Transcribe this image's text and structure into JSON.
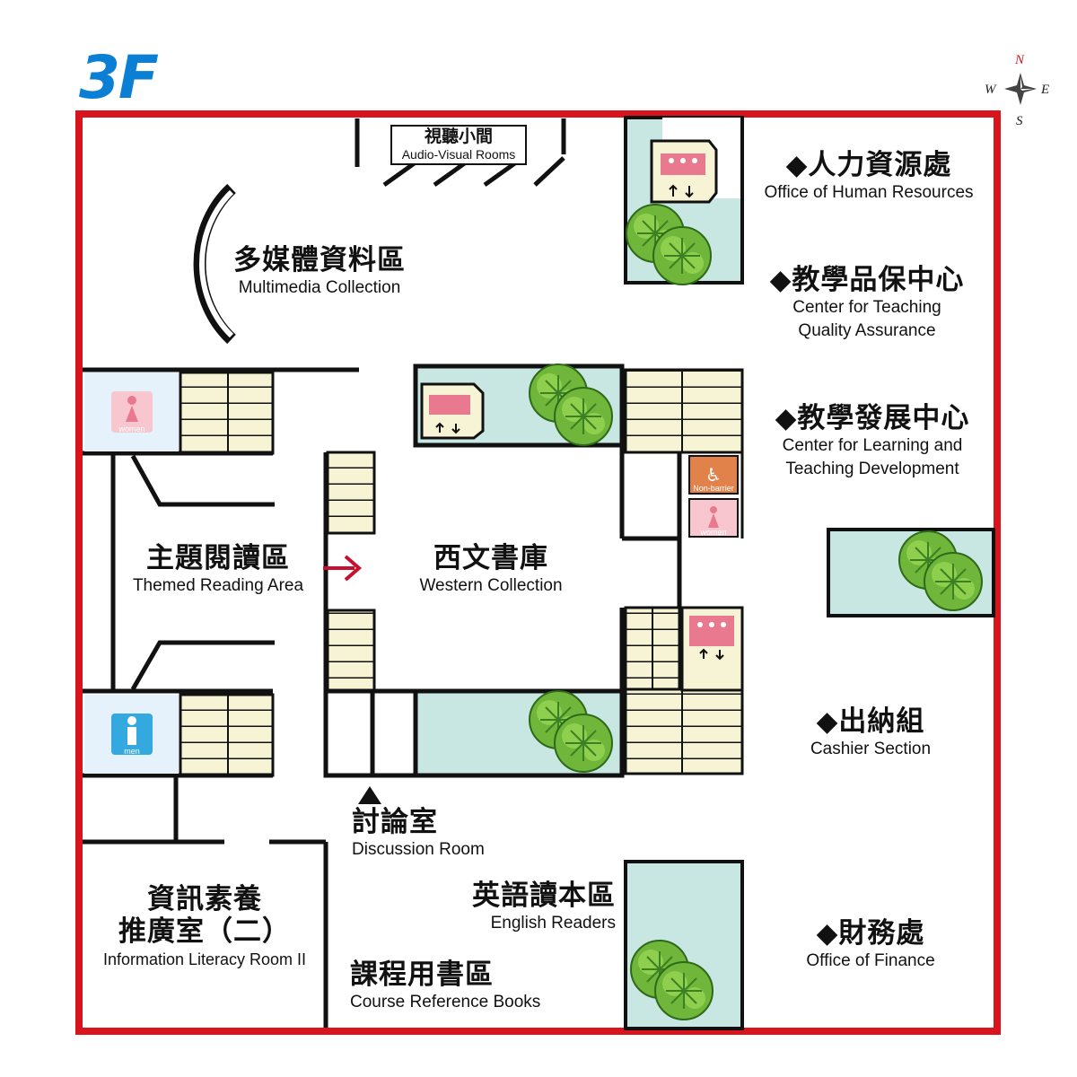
{
  "floor": "3F",
  "compass": {
    "n": "N",
    "s": "S",
    "e": "E",
    "w": "W"
  },
  "rooms": {
    "av_rooms": {
      "zh": "視聽小間",
      "en": "Audio-Visual Rooms"
    },
    "multimedia": {
      "zh": "多媒體資料區",
      "en": "Multimedia Collection"
    },
    "themed_reading": {
      "zh": "主題閱讀區",
      "en": "Themed Reading Area"
    },
    "western": {
      "zh": "西文書庫",
      "en": "Western Collection"
    },
    "discussion": {
      "zh": "討論室",
      "en": "Discussion Room"
    },
    "info_literacy": {
      "zh_line1": "資訊素養",
      "zh_line2": "推廣室（二）",
      "en": "Information Literacy Room II"
    },
    "english_readers": {
      "zh": "英語讀本區",
      "en": "English Readers"
    },
    "course_books": {
      "zh": "課程用書區",
      "en": "Course Reference Books"
    }
  },
  "offices": [
    {
      "zh": "◆人力資源處",
      "en": "Office of Human Resources"
    },
    {
      "zh": "◆教學品保中心",
      "en_line1": "Center for Teaching",
      "en_line2": "Quality Assurance"
    },
    {
      "zh": "◆教學發展中心",
      "en_line1": "Center for Learning and",
      "en_line2": "Teaching Development"
    },
    {
      "zh": "◆出納組",
      "en": "Cashier Section"
    },
    {
      "zh": "◆財務處",
      "en": "Office of Finance"
    }
  ],
  "restrooms": {
    "women": "women",
    "men": "men",
    "accessible": "Non-barrier"
  },
  "icons": [
    "elevator-icon",
    "stairs-icon",
    "tree-icon",
    "women-restroom-icon",
    "men-restroom-icon",
    "accessible-restroom-icon",
    "arrow-right-icon",
    "arrow-up-icon",
    "compass-icon"
  ],
  "colors": {
    "border": "#d9141c",
    "floor_label": "#0a7fd4",
    "planter": "#c8e6e2",
    "stairs": "#f6f4d4",
    "elevator": "#e8798e",
    "women_bg": "#f7c6cf",
    "men_bg": "#33a9e0",
    "arrow": "#c8102e"
  }
}
